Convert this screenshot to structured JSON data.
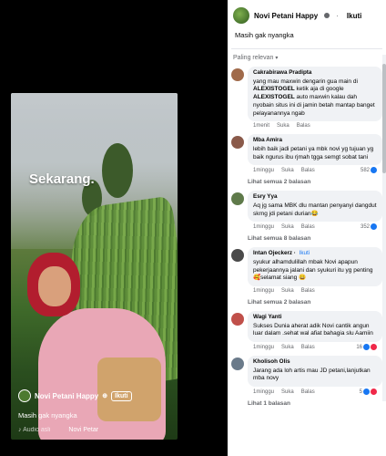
{
  "video": {
    "overlay_text": "Sekarang.",
    "author": "Novi Petani Happy",
    "follow_label": "Ikuti",
    "caption": "Masih gak nyangka",
    "audio_label": "Audio asli",
    "audio_author": "Novi Petar"
  },
  "post": {
    "author": "Novi Petani Happy",
    "follow_label": "Ikuti",
    "caption": "Masih gak nyangka",
    "sort_label": "Paling relevan"
  },
  "comments": [
    {
      "name": "Cakrabirawa Pradipta",
      "author_tag": "",
      "text_parts": [
        "yang mau maxwin dengarin gua main di ",
        "ALEXISTOGEL",
        " ketik aja di google ",
        "ALEXISTOGEL",
        " auto maxwin kalau dah nyobain situs ini di jamin betah mantap banget pelayanannya ngab"
      ],
      "time": "1menit",
      "like": "Suka",
      "reply": "Balas",
      "count": "",
      "avatar_color": "#a06a4a"
    },
    {
      "name": "Mba Amira",
      "author_tag": "",
      "text_parts": [
        "lebih baik jadi petani ya mbk novi yg tujuan yg baik ngurus ibu rjmah tgga semgt sobat tani"
      ],
      "time": "1minggu",
      "like": "Suka",
      "reply": "Balas",
      "count": "582",
      "replies": "Lihat semua 2 balasan",
      "avatar_color": "#8a5a4a"
    },
    {
      "name": "Esry Yya",
      "author_tag": "",
      "text_parts": [
        "Aq jg sama MBK dlu mantan penyanyi dangdut skrng jdi petani durian😂"
      ],
      "time": "1minggu",
      "like": "Suka",
      "reply": "Balas",
      "count": "352",
      "replies": "Lihat semua 8 balasan",
      "avatar_color": "#5f7a4a"
    },
    {
      "name": "Intan Ojeckerz",
      "author_tag": "Ikuti",
      "text_parts": [
        "syukur alhamdulillah mbak Novi apapun pekerjaannya jalani dan syukuri itu yg penting 🥰selamat siang 😀"
      ],
      "time": "1minggu",
      "like": "Suka",
      "reply": "Balas",
      "count": "",
      "replies": "Lihat semua 2 balasan",
      "avatar_color": "#4a4a4a"
    },
    {
      "name": "Wagi Yanti",
      "author_tag": "",
      "text_parts": [
        "Sukses Dunia aherat adik Novi cantik angun luar dalam .sehat wal afiat bahagia slu Aamiin"
      ],
      "time": "1minggu",
      "like": "Suka",
      "reply": "Balas",
      "count": "16",
      "avatar_color": "#c0504a"
    },
    {
      "name": "Kholisoh Olis",
      "author_tag": "",
      "text_parts": [
        "Jarang ada loh artis mau JD petani,lanjutkan mba novy"
      ],
      "time": "1minggu",
      "like": "Suka",
      "reply": "Balas",
      "count": "5",
      "replies": "Lihat 1 balasan",
      "avatar_color": "#6a7a8a"
    }
  ]
}
